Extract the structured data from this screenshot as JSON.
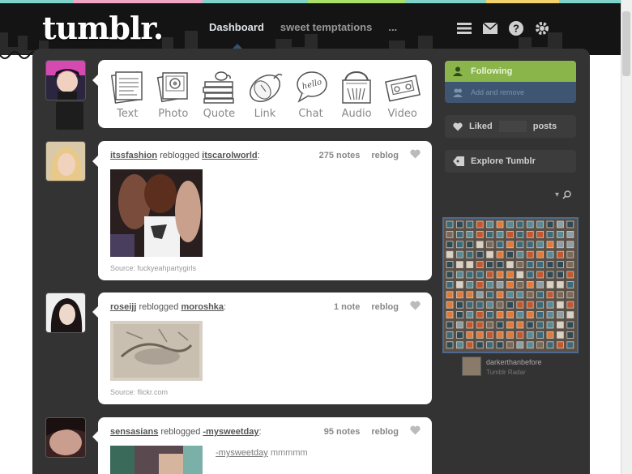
{
  "app": {
    "logo": "tumblr."
  },
  "nav": {
    "items": [
      {
        "label": "Dashboard",
        "active": true
      },
      {
        "label": "sweet temptations",
        "active": false
      },
      {
        "label": "...",
        "active": false
      }
    ],
    "icons": [
      "text-posts-icon",
      "inbox-icon",
      "help-icon",
      "preferences-icon"
    ]
  },
  "post_types": [
    {
      "label": "Text",
      "icon": "text-icon"
    },
    {
      "label": "Photo",
      "icon": "photo-icon"
    },
    {
      "label": "Quote",
      "icon": "quote-icon"
    },
    {
      "label": "Link",
      "icon": "link-icon"
    },
    {
      "label": "Chat",
      "icon": "chat-icon"
    },
    {
      "label": "Audio",
      "icon": "audio-icon"
    },
    {
      "label": "Video",
      "icon": "video-icon"
    }
  ],
  "chat_bubble_word": "hello",
  "posts": [
    {
      "user": "itssfashion",
      "action": "reblogged",
      "from": "itscarolworld",
      "notes": "275 notes",
      "reblog": "reblog",
      "source": "Source: fuckyeahpartygirls"
    },
    {
      "user": "roseijj",
      "action": "reblogged",
      "from": "moroshka",
      "notes": "1 note",
      "reblog": "reblog",
      "source": "Source: flickr.com"
    },
    {
      "user": "sensasians",
      "action": "reblogged",
      "from": "-mysweetday",
      "notes": "95 notes",
      "reblog": "reblog",
      "caption_user": "-mysweetday",
      "caption_text": "mmmmm"
    }
  ],
  "sidebar": {
    "following": "Following",
    "add_remove": "Add and remove",
    "liked": "Liked",
    "liked_count": "",
    "liked_suffix": "posts",
    "explore": "Explore Tumblr",
    "radar_user": "darkerthanbefore",
    "radar_label": "Tumblr Radar"
  },
  "colors": {
    "panel": "#333333",
    "following_green": "#8ab54b",
    "accent_blue": "#3e5672"
  }
}
